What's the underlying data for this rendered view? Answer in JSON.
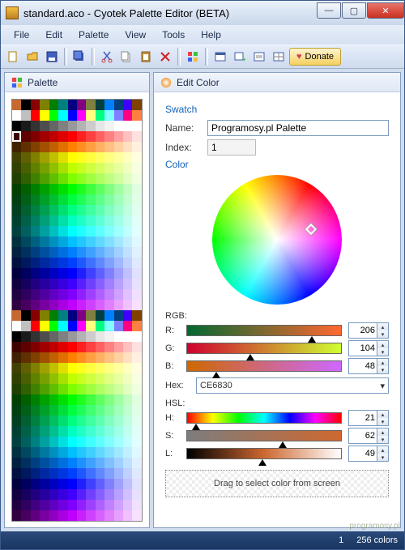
{
  "window": {
    "title": "standard.aco - Cyotek Palette Editor (BETA)"
  },
  "menu": {
    "file": "File",
    "edit": "Edit",
    "palette": "Palette",
    "view": "View",
    "tools": "Tools",
    "help": "Help"
  },
  "toolbar": {
    "donate": "Donate"
  },
  "tabs": {
    "palette": "Palette",
    "editcolor": "Edit Color"
  },
  "swatch": {
    "section": "Swatch",
    "name_label": "Name:",
    "name_value": "Programosy.pl Palette",
    "index_label": "Index:",
    "index_value": "1"
  },
  "color": {
    "section": "Color",
    "rgb_label": "RGB:",
    "r_label": "R:",
    "r_value": "206",
    "g_label": "G:",
    "g_value": "104",
    "b_label": "B:",
    "b_value": "48",
    "hex_label": "Hex:",
    "hex_value": "CE6830",
    "hsl_label": "HSL:",
    "h_label": "H:",
    "h_value": "21",
    "s_label": "S:",
    "s_value": "62",
    "l_label": "L:",
    "l_value": "49",
    "drag_hint": "Drag to select color from screen",
    "selected_hex": "#CE6830"
  },
  "status": {
    "index": "1",
    "count": "256 colors"
  },
  "watermark": "programosy.pl",
  "palette_rows": [
    [
      "#C66830",
      "#000",
      "#800",
      "#808000",
      "#008000",
      "#008080",
      "#000080",
      "#800080",
      "#808040",
      "#004040",
      "#0080FF",
      "#004080",
      "#4000FF",
      "#804000"
    ],
    [
      "#FFF",
      "#C0C0C0",
      "#F00",
      "#FF0",
      "#0F0",
      "#0FF",
      "#00F",
      "#F0F",
      "#FFFF80",
      "#00FF80",
      "#80FFFF",
      "#8080FF",
      "#FF0080",
      "#FF8040"
    ],
    [
      "#000",
      "#1a1a1a",
      "#333",
      "#4d4d4d",
      "#666",
      "#808080",
      "#999",
      "#b3b3b3",
      "#ccc",
      "#e6e6e6",
      "#f2f2f2",
      "#fff",
      "#fff",
      "#fff"
    ],
    [
      "#400000",
      "#600000",
      "#800000",
      "#a00000",
      "#c00000",
      "#e00000",
      "#ff0000",
      "#ff2020",
      "#ff4040",
      "#ff6060",
      "#ff8080",
      "#ffa0a0",
      "#ffc0c0",
      "#ffe0e0"
    ],
    [
      "#402000",
      "#603000",
      "#804000",
      "#a05000",
      "#c06000",
      "#e07000",
      "#ff8000",
      "#ff9020",
      "#ffa040",
      "#ffb060",
      "#ffc080",
      "#ffd0a0",
      "#ffe0c0",
      "#fff0e0"
    ],
    [
      "#404000",
      "#606000",
      "#808000",
      "#a0a000",
      "#c0c000",
      "#e0e000",
      "#ffff00",
      "#ffff20",
      "#ffff40",
      "#ffff60",
      "#ffff80",
      "#ffffa0",
      "#ffffc0",
      "#ffffe0"
    ],
    [
      "#304000",
      "#486000",
      "#608000",
      "#78a000",
      "#90c000",
      "#a8e000",
      "#c0ff00",
      "#c8ff20",
      "#d0ff40",
      "#d8ff60",
      "#e0ff80",
      "#e8ffa0",
      "#f0ffc0",
      "#f8ffe0"
    ],
    [
      "#204000",
      "#306000",
      "#408000",
      "#50a000",
      "#60c000",
      "#70e000",
      "#80ff00",
      "#90ff20",
      "#a0ff40",
      "#b0ff60",
      "#c0ff80",
      "#d0ffa0",
      "#e0ffc0",
      "#f0ffe0"
    ],
    [
      "#004000",
      "#006000",
      "#008000",
      "#00a000",
      "#00c000",
      "#00e000",
      "#00ff00",
      "#20ff20",
      "#40ff40",
      "#60ff60",
      "#80ff80",
      "#a0ffa0",
      "#c0ffc0",
      "#e0ffe0"
    ],
    [
      "#004010",
      "#006018",
      "#008020",
      "#00a028",
      "#00c030",
      "#00e038",
      "#00ff40",
      "#20ff58",
      "#40ff70",
      "#60ff88",
      "#80ffa0",
      "#a0ffb8",
      "#c0ffd0",
      "#e0ffe8"
    ],
    [
      "#004020",
      "#006030",
      "#008040",
      "#00a050",
      "#00c060",
      "#00e070",
      "#00ff80",
      "#20ff90",
      "#40ffa0",
      "#60ffb0",
      "#80ffc0",
      "#a0ffd0",
      "#c0ffe0",
      "#e0fff0"
    ],
    [
      "#004030",
      "#006048",
      "#008060",
      "#00a078",
      "#00c090",
      "#00e0a8",
      "#00ffc0",
      "#20ffc8",
      "#40ffd0",
      "#60ffd8",
      "#80ffe0",
      "#a0ffe8",
      "#c0fff0",
      "#e0fff8"
    ],
    [
      "#004040",
      "#006060",
      "#008080",
      "#00a0a0",
      "#00c0c0",
      "#00e0e0",
      "#00ffff",
      "#20ffff",
      "#40ffff",
      "#60ffff",
      "#80ffff",
      "#a0ffff",
      "#c0ffff",
      "#e0ffff"
    ],
    [
      "#003040",
      "#004860",
      "#006080",
      "#0078a0",
      "#0090c0",
      "#00a8e0",
      "#00c0ff",
      "#20c8ff",
      "#40d0ff",
      "#60d8ff",
      "#80e0ff",
      "#a0e8ff",
      "#c0f0ff",
      "#e0f8ff"
    ],
    [
      "#002040",
      "#003060",
      "#004080",
      "#0050a0",
      "#0060c0",
      "#0070e0",
      "#0080ff",
      "#2090ff",
      "#40a0ff",
      "#60b0ff",
      "#80c0ff",
      "#a0d0ff",
      "#c0e0ff",
      "#e0f0ff"
    ],
    [
      "#001040",
      "#001860",
      "#002080",
      "#0028a0",
      "#0030c0",
      "#0038e0",
      "#0040ff",
      "#2058ff",
      "#4070ff",
      "#6088ff",
      "#80a0ff",
      "#a0b8ff",
      "#c0d0ff",
      "#e0e8ff"
    ],
    [
      "#000040",
      "#000060",
      "#000080",
      "#0000a0",
      "#0000c0",
      "#0000e0",
      "#0000ff",
      "#2020ff",
      "#4040ff",
      "#6060ff",
      "#8080ff",
      "#a0a0ff",
      "#c0c0ff",
      "#e0e0ff"
    ],
    [
      "#100040",
      "#180060",
      "#200080",
      "#2800a0",
      "#3000c0",
      "#3800e0",
      "#4000ff",
      "#5820ff",
      "#7040ff",
      "#8860ff",
      "#a080ff",
      "#b8a0ff",
      "#d0c0ff",
      "#e8e0ff"
    ],
    [
      "#200040",
      "#300060",
      "#400080",
      "#5000a0",
      "#6000c0",
      "#7000e0",
      "#8000ff",
      "#9020ff",
      "#a040ff",
      "#b060ff",
      "#c080ff",
      "#d0a0ff",
      "#e0c0ff",
      "#f0e0ff"
    ],
    [
      "#300040",
      "#480060",
      "#600080",
      "#7800a0",
      "#9000c0",
      "#a800e0",
      "#c000ff",
      "#c820ff",
      "#d040ff",
      "#d860ff",
      "#e080ff",
      "#e8a0ff",
      "#f0c0ff",
      "#f8e0ff"
    ]
  ]
}
